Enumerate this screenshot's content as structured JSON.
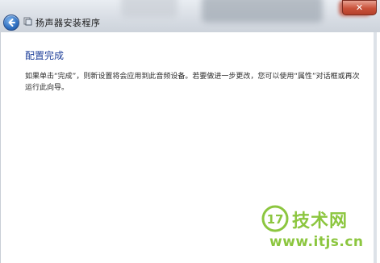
{
  "window": {
    "title": "扬声器安装程序",
    "close_label": "✕"
  },
  "page": {
    "heading": "配置完成",
    "body": "如果单击“完成”，则新设置将会应用到此音频设备。若要做进一步更改，您可以使用“属性”对话框或再次运行此向导。"
  },
  "watermark": {
    "logo_text": "17",
    "site_name": "技术网",
    "url": "www.itjs.cn"
  },
  "colors": {
    "heading": "#1e3f9a",
    "watermark": "#8cc63f",
    "close": "#c9523b"
  }
}
